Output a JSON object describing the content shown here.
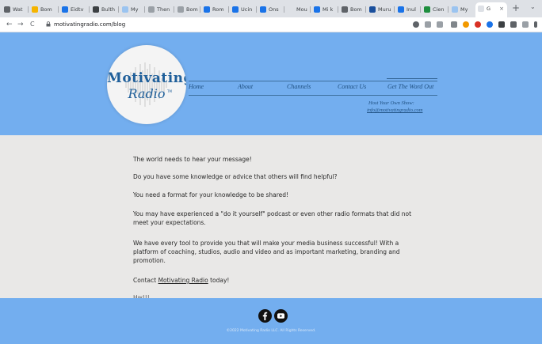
{
  "browser": {
    "tabs": [
      {
        "label": "Wat"
      },
      {
        "label": "Bom"
      },
      {
        "label": "Eidtv"
      },
      {
        "label": "Bulth"
      },
      {
        "label": "My"
      },
      {
        "label": "Then"
      },
      {
        "label": "Bom"
      },
      {
        "label": "Rom"
      },
      {
        "label": "Ucin"
      },
      {
        "label": "Ons"
      },
      {
        "label": "Mou"
      },
      {
        "label": "Mi k"
      },
      {
        "label": "Bom"
      },
      {
        "label": "Muru"
      },
      {
        "label": "Inul"
      },
      {
        "label": "Cien"
      },
      {
        "label": "My"
      },
      {
        "label": "G"
      }
    ],
    "url": "motivatingradio.com/blog",
    "nav": {
      "back": "←",
      "forward": "→",
      "reload": "C"
    },
    "new_tab": "+",
    "tab_close": "×",
    "window_control": "⌄"
  },
  "header": {
    "logo": {
      "line1": "Motivating",
      "line2": "Radio",
      "tm": "TM"
    },
    "menu": [
      "Home",
      "About",
      "Channels",
      "Contact Us",
      "Get The Word Out"
    ],
    "host_line": "Host Your Own Show:",
    "host_email": "info@motivatingradio.com"
  },
  "content": {
    "p1": "The world needs to hear your message!",
    "p2": "Do you have some knowledge or advice that others will find helpful?",
    "p3": "You need a format for your knowledge to be shared!",
    "p4": "You may have experienced a \"do it yourself\" podcast or even other radio formats that did not meet your expectations.",
    "p5": "We have every tool to provide you that will make your media business successful! With a platform of coaching, studios, audio and video and as important marketing, branding and promotion.",
    "p6_prefix": "Contact ",
    "p6_link": "Motivating Radio",
    "p6_suffix": " today!",
    "p7": "Hw!!!"
  },
  "footer": {
    "copyright": "©2022 Motivating Radio LLC. All Rights Reserved."
  },
  "colors": {
    "header_bg": "#73aeef",
    "content_bg": "#e9e8e7",
    "footer_bg": "#73aeef",
    "menu_text": "#1e4f80",
    "logo_text": "#1f5f9a"
  },
  "icons": [
    "back-arrow-icon",
    "forward-arrow-icon",
    "reload-icon",
    "lock-icon",
    "facebook-icon",
    "youtube-icon"
  ]
}
